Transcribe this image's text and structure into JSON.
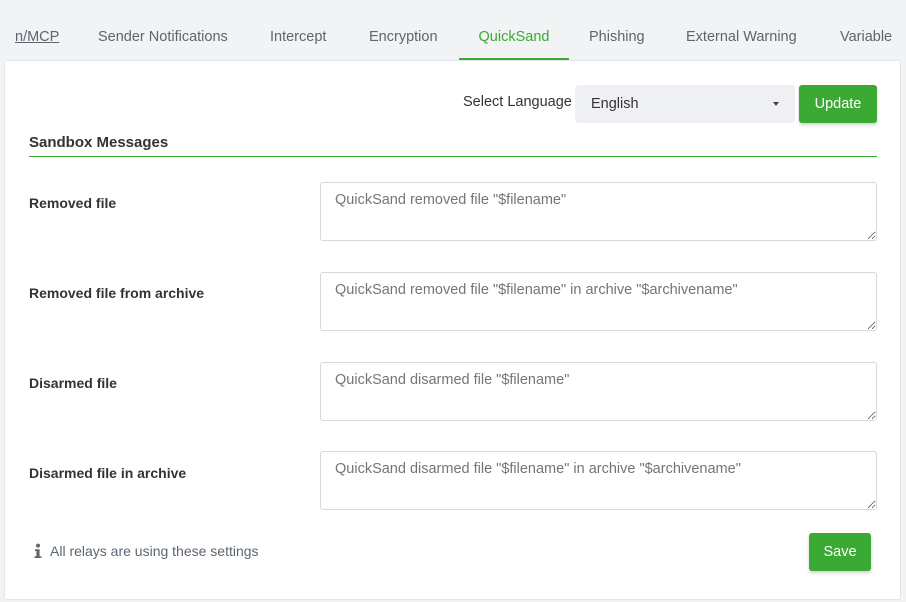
{
  "tabs": [
    {
      "label": "n/MCP",
      "active": false
    },
    {
      "label": "Sender Notifications",
      "active": false
    },
    {
      "label": "Intercept",
      "active": false
    },
    {
      "label": "Encryption",
      "active": false
    },
    {
      "label": "QuickSand",
      "active": true
    },
    {
      "label": "Phishing",
      "active": false
    },
    {
      "label": "External Warning",
      "active": false
    },
    {
      "label": "Variable",
      "active": false
    }
  ],
  "language": {
    "label": "Select Language",
    "selected": "English",
    "update_label": "Update"
  },
  "section": {
    "title": "Sandbox Messages"
  },
  "messages": [
    {
      "label": "Removed file",
      "value": "QuickSand removed file \"$filename\""
    },
    {
      "label": "Removed file from archive",
      "value": "QuickSand removed file \"$filename\" in archive \"$archivename\""
    },
    {
      "label": "Disarmed file",
      "value": "QuickSand disarmed file \"$filename\""
    },
    {
      "label": "Disarmed file in archive",
      "value": "QuickSand disarmed file \"$filename\" in archive \"$archivename\""
    }
  ],
  "footer": {
    "info_text": "All relays are using these settings",
    "info_icon": "info-icon",
    "save_label": "Save"
  },
  "colors": {
    "accent": "#3aaa35",
    "background": "#f1f3f4"
  }
}
